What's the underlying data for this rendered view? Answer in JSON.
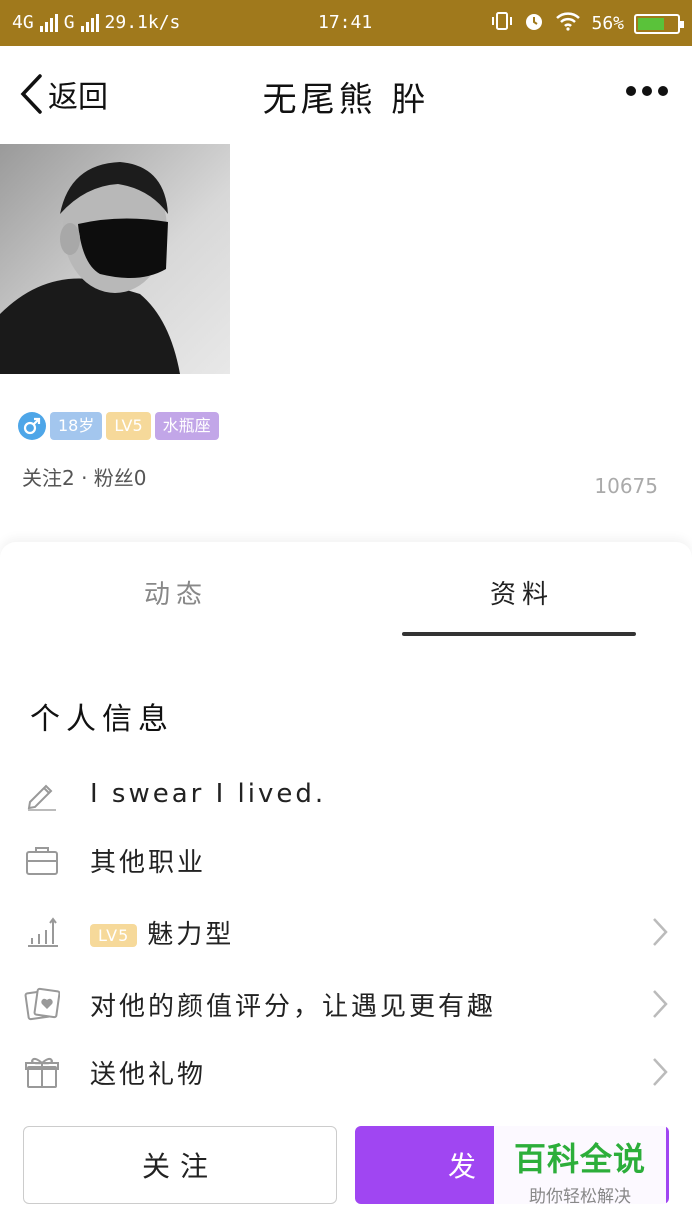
{
  "status_bar": {
    "network1": "4G",
    "network2": "G",
    "speed": "29.1k/s",
    "time": "17:41",
    "battery": "56%"
  },
  "nav": {
    "back_label": "返回",
    "title": "无尾熊 肸"
  },
  "profile": {
    "age": "18岁",
    "level": "LV5",
    "zodiac": "水瓶座",
    "follow_stats": "关注2 · 粉丝0",
    "visit_count": "10675"
  },
  "tabs": {
    "posts": "动态",
    "profile": "资料"
  },
  "info": {
    "section_title": "个人信息",
    "signature": "I swear I lived.",
    "occupation": "其他职业",
    "charm_level": "LV5",
    "charm_type": "魅力型",
    "rate_prompt": "对他的颜值评分，让遇见更有趣",
    "gift_prompt": "送他礼物"
  },
  "actions": {
    "follow": "关注",
    "message": "发"
  },
  "watermark": {
    "title": "百科全说",
    "subtitle": "助你轻松解决"
  }
}
